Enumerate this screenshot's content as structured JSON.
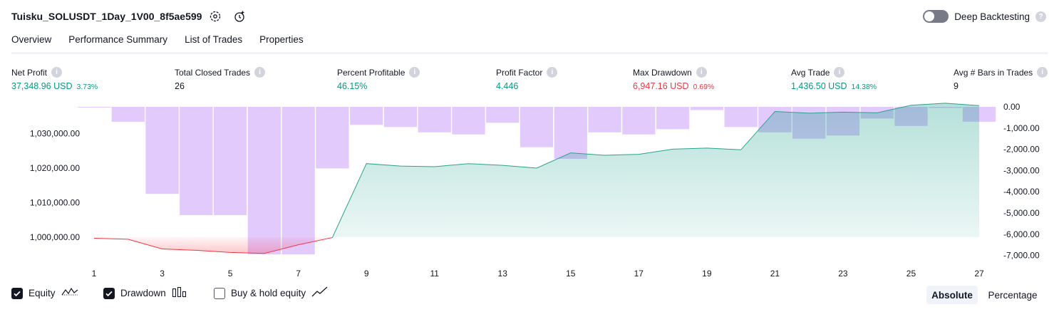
{
  "header": {
    "title": "Tuisku_SOLUSDT_1Day_1V00_8f5ae599",
    "deep_backtesting_label": "Deep Backtesting"
  },
  "tabs": [
    {
      "label": "Overview",
      "active": true
    },
    {
      "label": "Performance Summary",
      "active": false
    },
    {
      "label": "List of Trades",
      "active": false
    },
    {
      "label": "Properties",
      "active": false
    }
  ],
  "metrics": [
    {
      "label": "Net Profit",
      "value": "37,348.96 USD",
      "pct": "3.73%",
      "tone": "green"
    },
    {
      "label": "Total Closed Trades",
      "value": "26",
      "pct": "",
      "tone": "dark"
    },
    {
      "label": "Percent Profitable",
      "value": "46.15%",
      "pct": "",
      "tone": "green"
    },
    {
      "label": "Profit Factor",
      "value": "4.446",
      "pct": "",
      "tone": "green"
    },
    {
      "label": "Max Drawdown",
      "value": "6,947.16 USD",
      "pct": "0.69%",
      "tone": "red"
    },
    {
      "label": "Avg Trade",
      "value": "1,436.50 USD",
      "pct": "14.38%",
      "tone": "green"
    },
    {
      "label": "Avg # Bars in Trades",
      "value": "9",
      "pct": "",
      "tone": "dark"
    }
  ],
  "colors": {
    "green": "#089981",
    "red": "#f23645",
    "equity_line_up": "#2aa38a",
    "equity_line_down": "#f23645",
    "drawdown_bar": "#e1c5fd",
    "accent_dark": "#131722"
  },
  "chart_data": {
    "type": "line+bar",
    "left_axis": {
      "ticks": [
        "1,030,000.00",
        "1,020,000.00",
        "1,010,000.00",
        "1,000,000.00"
      ],
      "values": [
        1030000,
        1020000,
        1010000,
        1000000
      ]
    },
    "right_axis": {
      "ticks": [
        "0.00",
        "-1,000.00",
        "-2,000.00",
        "-3,000.00",
        "-4,000.00",
        "-5,000.00",
        "-6,000.00",
        "-7,000.00"
      ],
      "values": [
        0,
        -1000,
        -2000,
        -3000,
        -4000,
        -5000,
        -6000,
        -7000
      ]
    },
    "x_ticks": [
      "1",
      "3",
      "5",
      "7",
      "9",
      "11",
      "13",
      "15",
      "17",
      "19",
      "21",
      "23",
      "25",
      "27"
    ],
    "baseline_equity": 1000000,
    "series": [
      {
        "name": "Equity",
        "x": [
          1,
          2,
          3,
          4,
          5,
          6,
          7,
          8,
          9,
          10,
          11,
          12,
          13,
          14,
          15,
          16,
          17,
          18,
          19,
          20,
          21,
          22,
          23,
          24,
          25,
          26,
          27
        ],
        "values": [
          999700,
          999400,
          996600,
          996200,
          995600,
          995300,
          997800,
          999900,
          1021300,
          1020600,
          1020400,
          1021300,
          1020800,
          1020000,
          1024400,
          1023700,
          1024000,
          1025500,
          1025800,
          1025300,
          1036400,
          1035900,
          1036200,
          1036000,
          1038200,
          1038800,
          1038100
        ]
      },
      {
        "name": "Drawdown",
        "x": [
          1,
          2,
          3,
          4,
          5,
          6,
          7,
          8,
          9,
          10,
          11,
          12,
          13,
          14,
          15,
          16,
          17,
          18,
          19,
          20,
          21,
          22,
          23,
          24,
          25,
          26,
          27
        ],
        "values": [
          0,
          -700,
          -4100,
          -5100,
          -5100,
          -6950,
          -6950,
          -2900,
          -850,
          -950,
          -1200,
          -1300,
          -750,
          -1900,
          -2450,
          -1200,
          -1300,
          -1050,
          -150,
          -950,
          -1200,
          -1500,
          -1350,
          -550,
          -900,
          -50,
          -700
        ]
      }
    ],
    "legend_position": "bottom-left"
  },
  "legend": [
    {
      "label": "Equity",
      "checked": true,
      "icon": "equity-line-icon"
    },
    {
      "label": "Drawdown",
      "checked": true,
      "icon": "drawdown-bars-icon"
    },
    {
      "label": "Buy & hold equity",
      "checked": false,
      "icon": "buy-hold-line-icon"
    }
  ],
  "view_modes": [
    {
      "label": "Absolute",
      "active": true
    },
    {
      "label": "Percentage",
      "active": false
    }
  ]
}
